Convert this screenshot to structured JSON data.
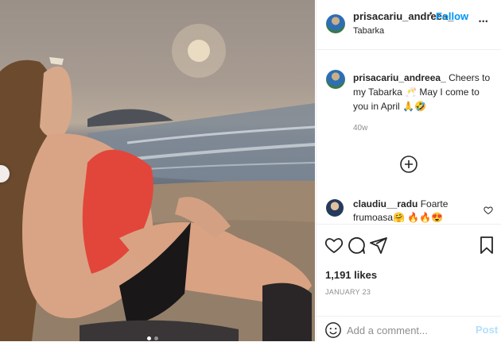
{
  "post": {
    "author": {
      "username": "prisacariu_andreea_",
      "location": "Tabarka",
      "follow_label": "Follow",
      "separator": "•",
      "more_label": "•••"
    },
    "caption": {
      "username": "prisacariu_andreea_",
      "text": "Cheers to my Tabarka 🥂 May I come to you in April 🙏🤣",
      "age": "40w"
    },
    "load_more_icon": "plus-circle-icon",
    "comments": [
      {
        "username": "claudiu__radu",
        "text": "Foarte frumoasa🤗 🔥🔥😍"
      }
    ],
    "actions": {
      "icons": [
        "heart-icon",
        "comment-icon",
        "share-icon",
        "bookmark-icon"
      ],
      "likes": "1,191 likes",
      "date": "JANUARY 23"
    },
    "composer": {
      "placeholder": "Add a comment...",
      "post_label": "Post",
      "emoji_icon": "emoji-icon"
    },
    "carousel": {
      "slide_count": 2,
      "active_index": 0
    }
  }
}
